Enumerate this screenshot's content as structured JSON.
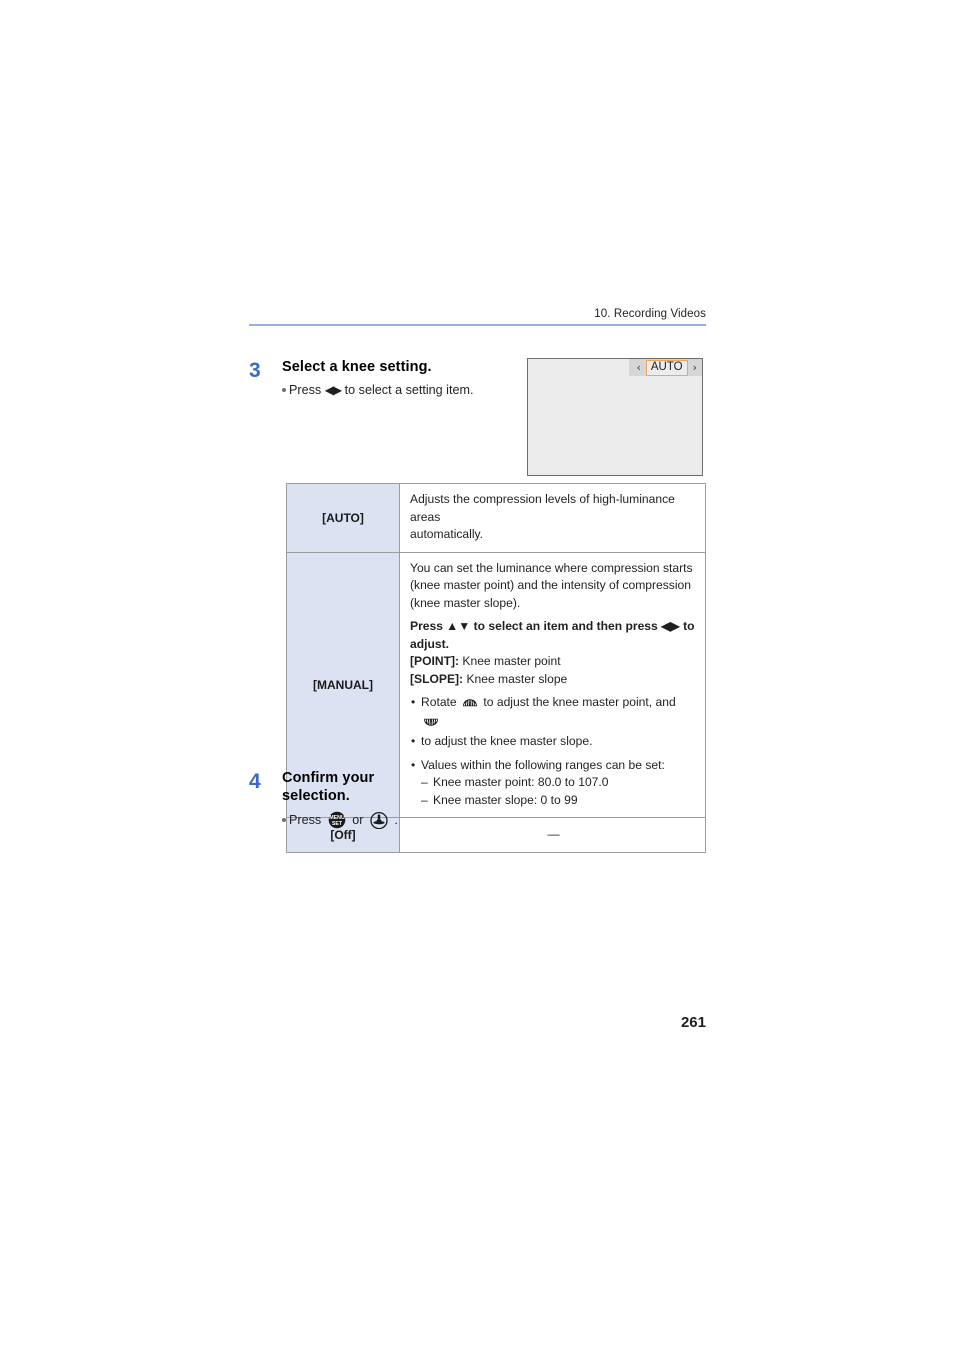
{
  "header": {
    "chapter": "10. Recording Videos",
    "rule_color": "#98aee0"
  },
  "page_number": "261",
  "steps": [
    {
      "number": "3",
      "title": "Select a knee setting.",
      "bullet_prefix": "Press",
      "bullet_arrows": "◀▶",
      "bullet_suffix": "to select a setting item."
    },
    {
      "number": "4",
      "title": "Confirm your selection.",
      "bullet_prefix": "Press",
      "bullet_middle": "or",
      "bullet_suffix": "."
    }
  ],
  "screen_illustration": {
    "left_chevron": "‹",
    "right_chevron": "›",
    "selected_value": "AUTO",
    "highlight_color": "#e8a95c",
    "bar_color": "#d6d6d6",
    "screen_color": "#ececec"
  },
  "table": {
    "rows": [
      {
        "key": "[AUTO]",
        "lines": [
          {
            "text": "Adjusts the compression levels of high-luminance areas",
            "style": "normal"
          },
          {
            "text": "automatically.",
            "style": "normal"
          }
        ]
      },
      {
        "key": "[MANUAL]",
        "lines": [
          {
            "text": "You can set the luminance where compression starts",
            "style": "normal"
          },
          {
            "text": "(knee master point) and the intensity of compression",
            "style": "normal"
          },
          {
            "text": "(knee master slope).",
            "style": "normal"
          },
          {
            "text": "Press ▲▼ to select an item and then press ◀▶ to",
            "style": "bold"
          },
          {
            "text": "adjust.",
            "style": "bold"
          },
          {
            "text": "[POINT]:",
            "style": "bold-label",
            "rest": " Knee master point"
          },
          {
            "text": "[SLOPE]:",
            "style": "bold-label",
            "rest": " Knee master slope"
          },
          {
            "text": "Rotate",
            "style": "bullet-dial",
            "rest": "to adjust the knee master point, and"
          },
          {
            "text": "to adjust the knee master slope.",
            "style": "indent"
          },
          {
            "text": "Values within the following ranges can be set:",
            "style": "bullet"
          },
          {
            "text": "Knee master point: 80.0 to 107.0",
            "style": "dash"
          },
          {
            "text": "Knee master slope: 0 to 99",
            "style": "dash"
          }
        ]
      },
      {
        "key": "[Off]",
        "value": "—"
      }
    ]
  },
  "icons": {
    "front_dial": "front-dial-icon",
    "rear_dial": "rear-dial-icon",
    "menu_set_button": "menu-set-button-icon",
    "joystick_button": "joystick-icon",
    "menu_set_line1": "MENU",
    "menu_set_line2": "SET"
  },
  "colors": {
    "step_number": "#3a6bc4",
    "table_key_bg": "#dbe2f1",
    "table_border": "#9b9b9b"
  }
}
